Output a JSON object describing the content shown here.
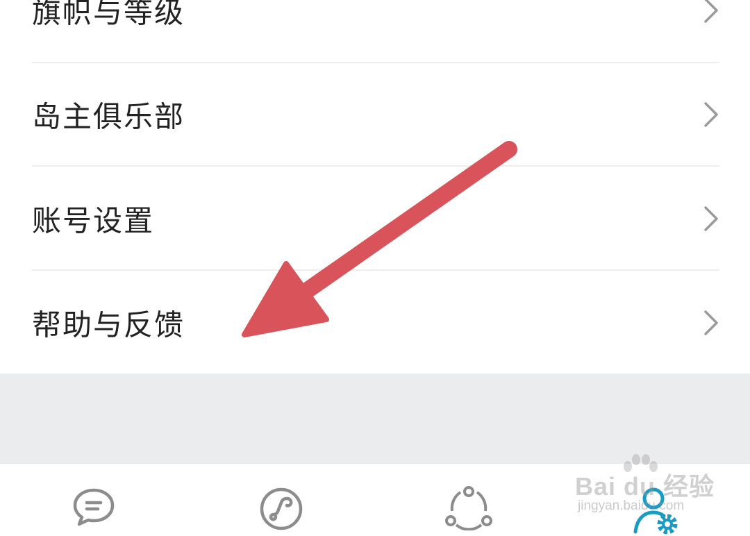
{
  "menu": {
    "items": [
      {
        "label": "旗帜与等级",
        "icon": "chevron-right-icon"
      },
      {
        "label": "岛主俱乐部",
        "icon": "chevron-right-icon"
      },
      {
        "label": "账号设置",
        "icon": "chevron-right-icon"
      },
      {
        "label": "帮助与反馈",
        "icon": "chevron-right-icon"
      }
    ]
  },
  "tabbar": {
    "tabs": [
      {
        "icon": "chat-bubble-icon",
        "active": false
      },
      {
        "icon": "link-circle-icon",
        "active": false
      },
      {
        "icon": "share-nodes-icon",
        "active": false
      },
      {
        "icon": "user-settings-icon",
        "active": true
      }
    ]
  },
  "annotation": {
    "icon": "red-arrow-icon",
    "color": "#d9535a"
  },
  "watermark": {
    "brand": "Bai du 经验",
    "url": "jingyan.baidu.com"
  },
  "colors": {
    "text": "#222222",
    "chevron": "#9a9a9a",
    "divider": "#eeeeee",
    "gray_area": "#ebecee",
    "tab_inactive": "#8c8c8c",
    "tab_active": "#1a9bc4"
  }
}
